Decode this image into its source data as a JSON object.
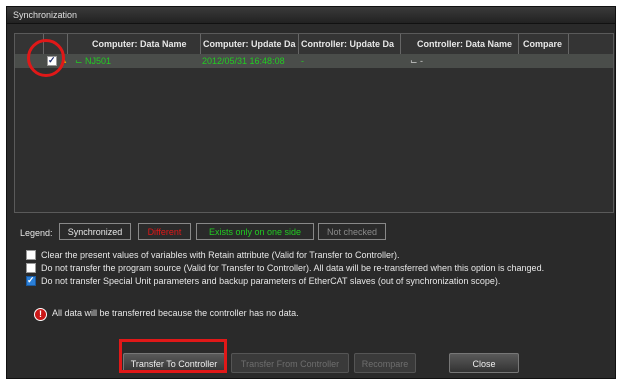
{
  "window": {
    "title": "Synchronization"
  },
  "table": {
    "columns": [
      "Computer: Data Name",
      "Computer: Update Da",
      "Controller: Update Da",
      "Controller: Data Name",
      "Compare"
    ],
    "rows": [
      {
        "checked": true,
        "computer_name": "NJ501",
        "computer_update": "2012/05/31 16:48:08",
        "controller_update": "-",
        "controller_name": "-",
        "compare": ""
      }
    ]
  },
  "legend": {
    "label": "Legend:",
    "items": [
      {
        "label": "Synchronized",
        "color": "#e8e8e8"
      },
      {
        "label": "Different",
        "color": "#e01818"
      },
      {
        "label": "Exists only on one side",
        "color": "#22cc22"
      },
      {
        "label": "Not checked",
        "color": "#8a8a8a"
      }
    ]
  },
  "options": [
    {
      "label": "Clear the present values of variables with Retain attribute (Valid for Transfer to Controller).",
      "checked": false
    },
    {
      "label": "Do not transfer the program source (Valid for Transfer to Controller). All data will be re-transferred when this option is changed.",
      "checked": false
    },
    {
      "label": "Do not transfer Special Unit parameters and backup parameters of EtherCAT slaves (out of synchronization scope).",
      "checked": true
    }
  ],
  "message": "All data will be transferred because the controller has no data.",
  "buttons": {
    "transfer_to": "Transfer To Controller",
    "transfer_from": "Transfer From Controller",
    "recompare": "Recompare",
    "close": "Close"
  },
  "colors": {
    "highlight": "#e01818",
    "green": "#22cc22"
  }
}
